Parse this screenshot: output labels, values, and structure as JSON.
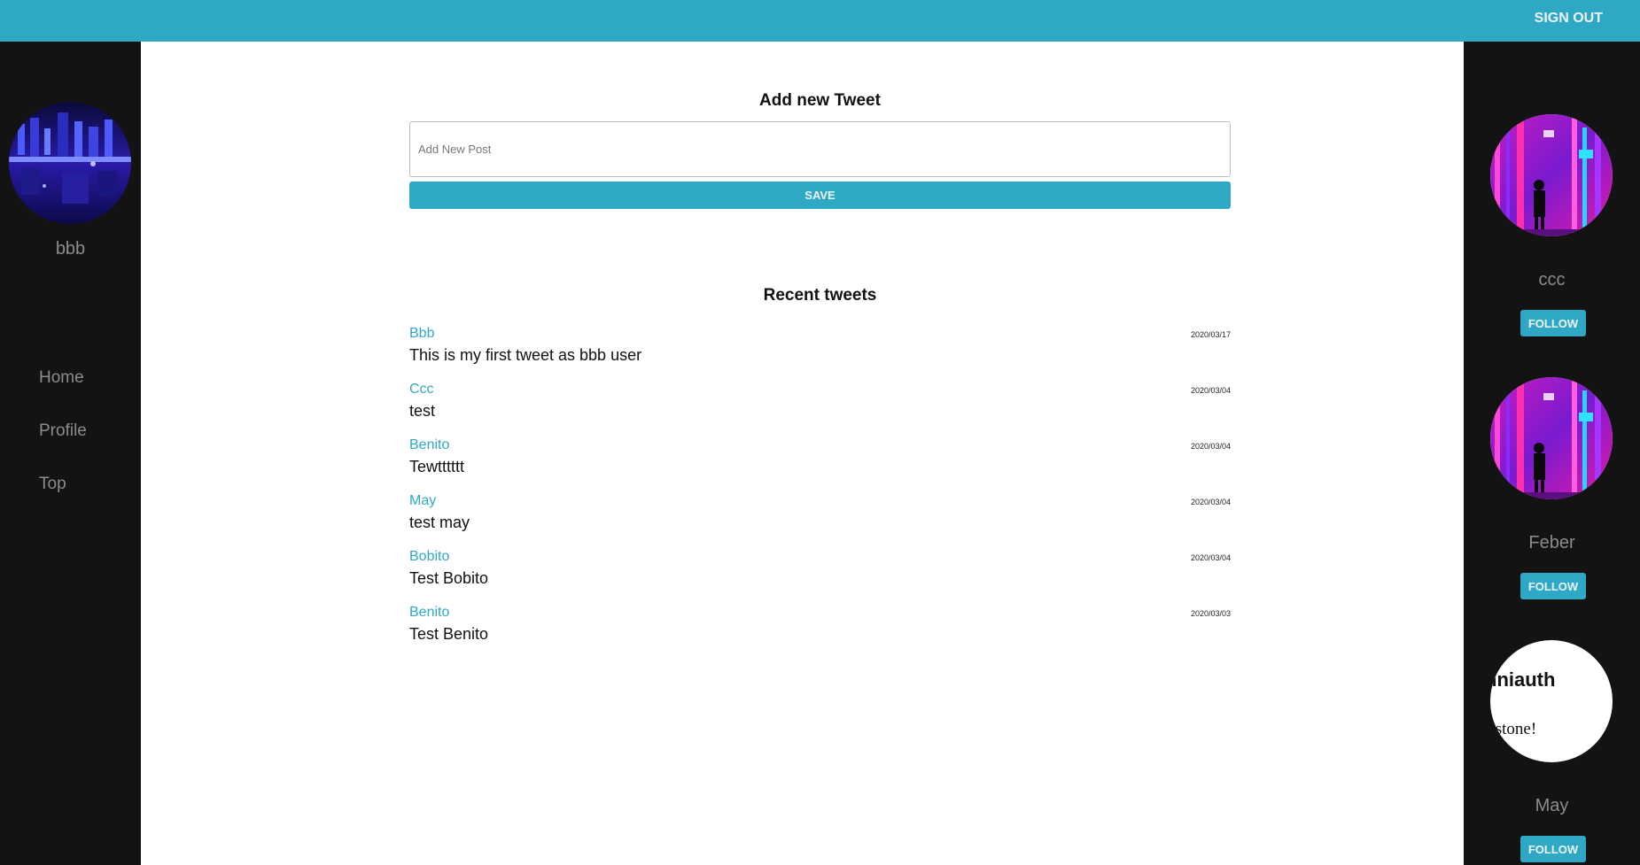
{
  "header": {
    "signout_label": "SIGN OUT"
  },
  "sidebar": {
    "username": "bbb",
    "nav": [
      {
        "label": "Home"
      },
      {
        "label": "Profile"
      },
      {
        "label": "Top"
      }
    ]
  },
  "compose": {
    "title": "Add new Tweet",
    "placeholder": "Add New Post",
    "value": "",
    "save_label": "SAVE"
  },
  "feed": {
    "title": "Recent tweets",
    "tweets": [
      {
        "author": "Bbb",
        "date": "2020/03/17",
        "text": "This is my first tweet as bbb user"
      },
      {
        "author": "Ccc",
        "date": "2020/03/04",
        "text": "test"
      },
      {
        "author": "Benito",
        "date": "2020/03/04",
        "text": "Tewtttttt"
      },
      {
        "author": "May",
        "date": "2020/03/04",
        "text": "test may"
      },
      {
        "author": "Bobito",
        "date": "2020/03/04",
        "text": "Test Bobito"
      },
      {
        "author": "Benito",
        "date": "2020/03/03",
        "text": "Test Benito"
      }
    ]
  },
  "suggestions": {
    "follow_label": "FOLLOW",
    "users": [
      {
        "name": "ccc",
        "avatar": "neon-city-figure"
      },
      {
        "name": "Feber",
        "avatar": "neon-city-figure"
      },
      {
        "name": "May",
        "avatar": "text-image",
        "avatar_text_line1": "nniauth",
        "avatar_text_line2": "lestone!"
      }
    ]
  },
  "colors": {
    "accent": "#2fa8c6",
    "sidebar_bg": "#131313",
    "muted_text": "#8c8c8c"
  }
}
